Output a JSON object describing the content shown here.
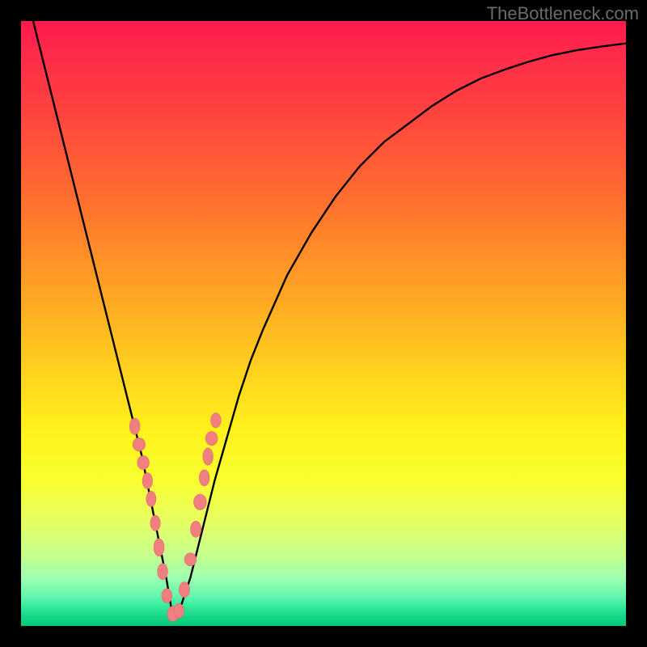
{
  "watermark": "TheBottleneck.com",
  "colors": {
    "curve": "#000000",
    "marker_fill": "#f08080",
    "marker_stroke": "#e26a6a"
  },
  "chart_data": {
    "type": "line",
    "title": "",
    "xlabel": "",
    "ylabel": "",
    "xlim": [
      0,
      100
    ],
    "ylim": [
      0,
      100
    ],
    "notes": "V-shaped bottleneck curve; minimum near x≈25; y interpreted as percent (0 bottom, 100 top). Markers are the small blobby points plotted along the lower section of the V.",
    "series": [
      {
        "name": "curve",
        "x": [
          0,
          2,
          4,
          6,
          8,
          10,
          12,
          14,
          16,
          18,
          20,
          22,
          24,
          25,
          26,
          28,
          30,
          32,
          34,
          36,
          38,
          40,
          44,
          48,
          52,
          56,
          60,
          64,
          68,
          72,
          76,
          80,
          84,
          88,
          92,
          96,
          100
        ],
        "y": [
          108,
          100,
          92,
          84,
          76,
          68,
          60,
          52,
          44,
          36,
          28,
          18,
          8,
          2,
          2,
          8,
          16,
          24,
          31,
          38,
          44,
          49,
          58,
          65,
          71,
          76,
          80,
          83,
          86,
          88.5,
          90.5,
          92,
          93.3,
          94.4,
          95.2,
          95.8,
          96.3
        ]
      }
    ],
    "markers": {
      "x": [
        18.8,
        19.5,
        20.2,
        20.9,
        21.5,
        22.2,
        22.8,
        23.4,
        24.1,
        25.1,
        26.1,
        27.0,
        28.0,
        28.9,
        29.6,
        30.3,
        30.9,
        31.5,
        32.2
      ],
      "y": [
        33,
        30,
        27,
        24,
        21,
        17,
        13,
        9,
        5,
        2,
        2.5,
        6,
        11,
        16,
        20.5,
        24.5,
        28,
        31,
        34
      ]
    }
  }
}
